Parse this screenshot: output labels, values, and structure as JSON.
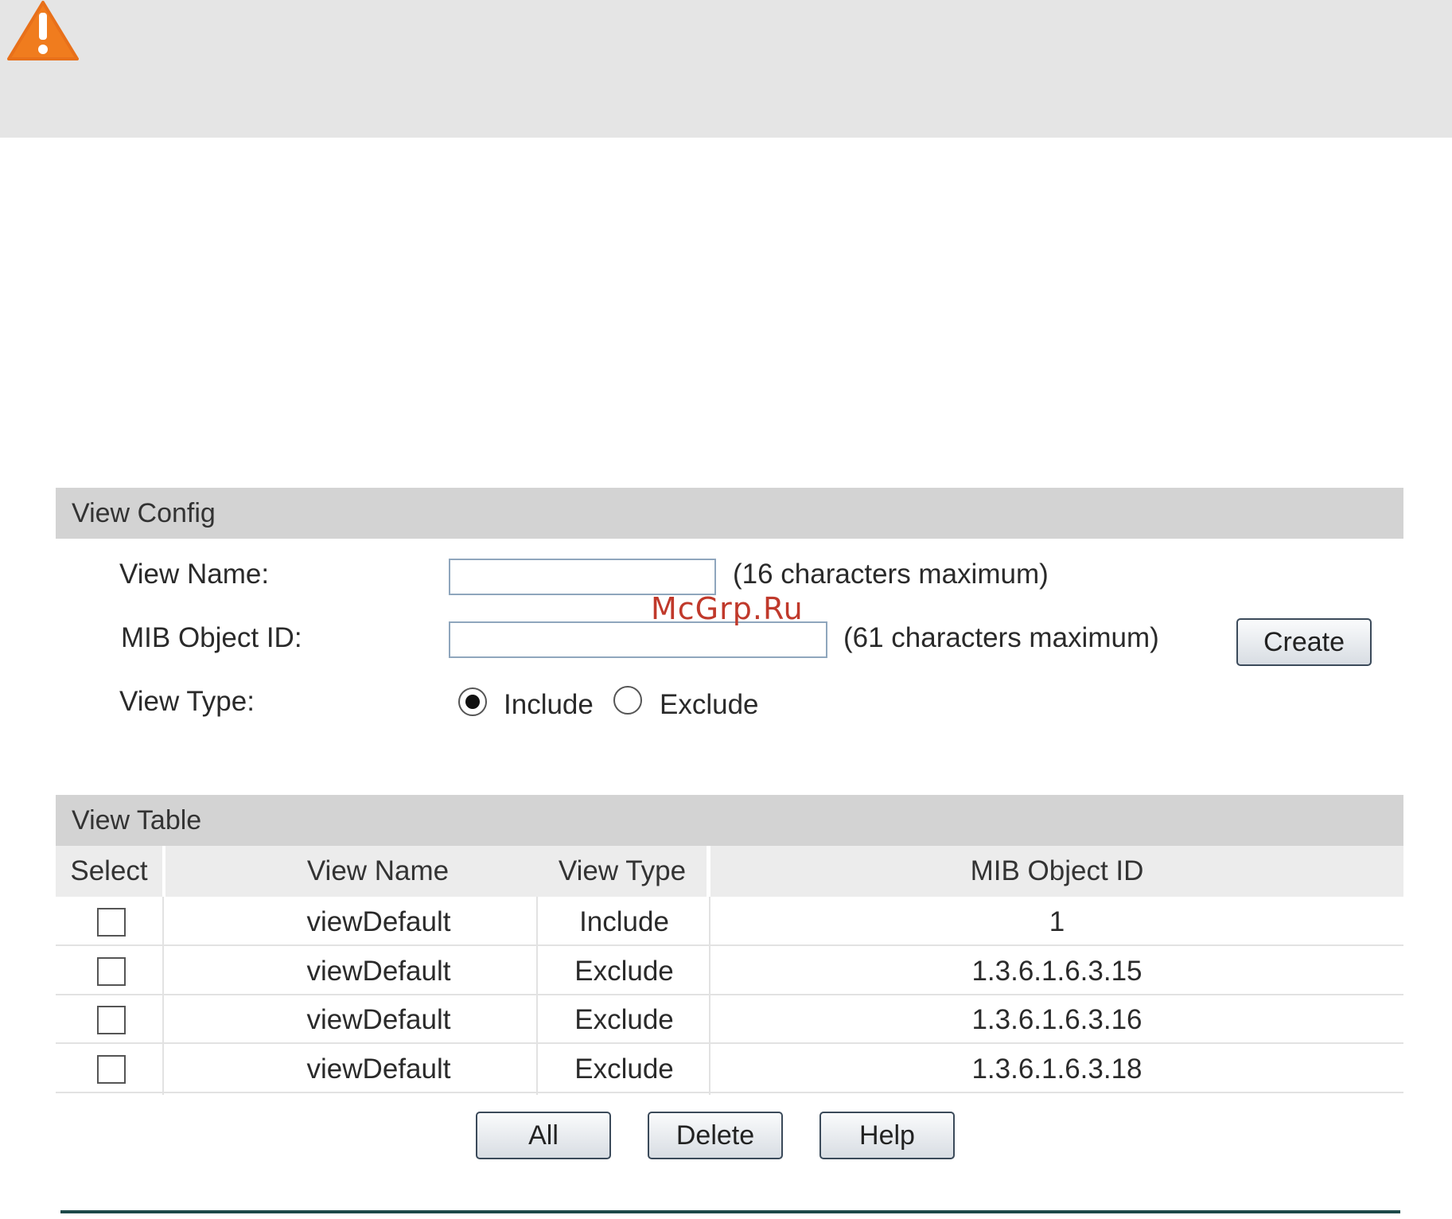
{
  "notice": {
    "icon": "warning-icon",
    "accent_color": "#f07c1e"
  },
  "watermark": "McGrp.Ru",
  "view_config": {
    "title": "View Config",
    "view_name_label": "View Name:",
    "view_name_value": "",
    "view_name_hint": "(16 characters maximum)",
    "mib_object_id_label": "MIB Object ID:",
    "mib_object_id_value": "",
    "mib_object_id_hint": "(61 characters maximum)",
    "view_type_label": "View Type:",
    "view_type_options": [
      "Include",
      "Exclude"
    ],
    "view_type_selected": "Include",
    "create_button": "Create"
  },
  "view_table": {
    "title": "View Table",
    "columns": [
      "Select",
      "View Name",
      "View Type",
      "MIB Object ID"
    ],
    "rows": [
      {
        "selected": false,
        "view_name": "viewDefault",
        "view_type": "Include",
        "mib_object_id": "1"
      },
      {
        "selected": false,
        "view_name": "viewDefault",
        "view_type": "Exclude",
        "mib_object_id": "1.3.6.1.6.3.15"
      },
      {
        "selected": false,
        "view_name": "viewDefault",
        "view_type": "Exclude",
        "mib_object_id": "1.3.6.1.6.3.16"
      },
      {
        "selected": false,
        "view_name": "viewDefault",
        "view_type": "Exclude",
        "mib_object_id": "1.3.6.1.6.3.18"
      }
    ],
    "buttons": {
      "all": "All",
      "delete": "Delete",
      "help": "Help"
    }
  }
}
